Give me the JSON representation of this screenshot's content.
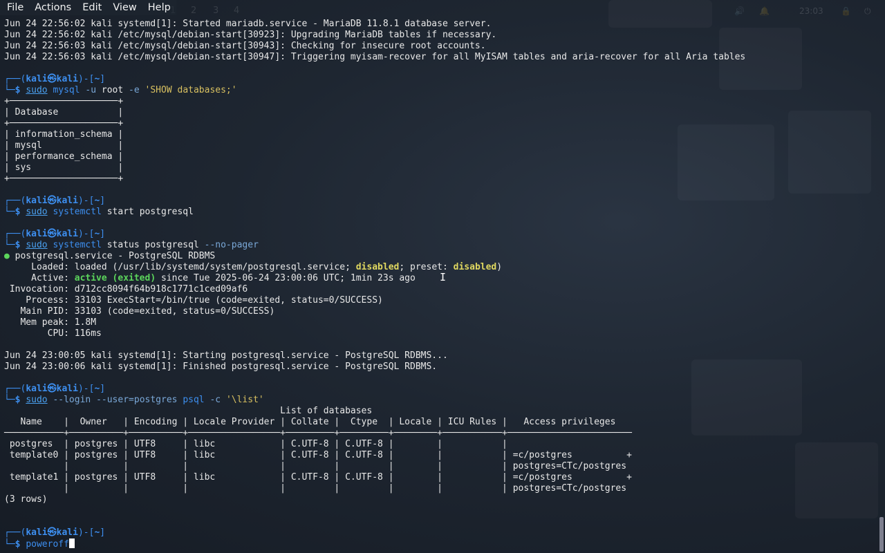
{
  "menu": {
    "items": [
      "File",
      "Actions",
      "Edit",
      "View",
      "Help"
    ]
  },
  "topbar": {
    "workspaces": [
      "1",
      "2",
      "3",
      "4"
    ],
    "clock": "23:03"
  },
  "terminal": {
    "lines": [
      "Jun 24 22:56:02 kali systemd[1]: Started mariadb.service - MariaDB 11.8.1 database server.",
      "Jun 24 22:56:02 kali /etc/mysql/debian-start[30923]: Upgrading MariaDB tables if necessary.",
      "Jun 24 22:56:03 kali /etc/mysql/debian-start[30943]: Checking for insecure root accounts.",
      "Jun 24 22:56:03 kali /etc/mysql/debian-start[30947]: Triggering myisam-recover for all MyISAM tables and aria-recover for all Aria tables",
      "",
      "PROMPT",
      "CMD1",
      "+────────────────────+",
      "| Database           |",
      "+────────────────────+",
      "| information_schema |",
      "| mysql              |",
      "| performance_schema |",
      "| sys                |",
      "+────────────────────+",
      "",
      "PROMPT",
      "CMD2",
      "",
      "PROMPT",
      "CMD3",
      "STATUS1",
      "STATUS2",
      "STATUS3",
      " Invocation: d712cc8094f64b918c1771c1ced09af6",
      "    Process: 33103 ExecStart=/bin/true (code=exited, status=0/SUCCESS)",
      "   Main PID: 33103 (code=exited, status=0/SUCCESS)",
      "   Mem peak: 1.8M",
      "        CPU: 116ms",
      "",
      "Jun 24 23:00:05 kali systemd[1]: Starting postgresql.service - PostgreSQL RDBMS...",
      "Jun 24 23:00:06 kali systemd[1]: Finished postgresql.service - PostgreSQL RDBMS.",
      "",
      "PROMPT",
      "CMD4",
      "                                                   List of databases",
      "   Name    |  Owner   | Encoding | Locale Provider | Collate |  Ctype  | Locale | ICU Rules |   Access privileges   ",
      "───────────+──────────+──────────+─────────────────+─────────+─────────+────────+───────────+───────────────────────",
      " postgres  | postgres | UTF8     | libc            | C.UTF-8 | C.UTF-8 |        |           | ",
      " template0 | postgres | UTF8     | libc            | C.UTF-8 | C.UTF-8 |        |           | =c/postgres          +",
      "           |          |          |                 |         |         |        |           | postgres=CTc/postgres",
      " template1 | postgres | UTF8     | libc            | C.UTF-8 | C.UTF-8 |        |           | =c/postgres          +",
      "           |          |          |                 |         |         |        |           | postgres=CTc/postgres",
      "(3 rows)",
      "",
      "",
      "PROMPT",
      "CMD5"
    ],
    "prompt": {
      "open": "┌──(",
      "user": "kali",
      "at": "㉿",
      "host": "kali",
      "mid": ")-[",
      "dir": "~",
      "close": "]",
      "second": "└─$ "
    },
    "cmd1": {
      "sudo": "sudo",
      "bin": "mysql",
      "opt1": "-u",
      "arg1": "root",
      "opt2": "-e",
      "str": "'SHOW databases;'"
    },
    "cmd2": {
      "sudo": "sudo",
      "bin": "systemctl",
      "rest": "start postgresql"
    },
    "cmd3": {
      "sudo": "sudo",
      "bin": "systemctl",
      "rest": "status postgresql",
      "opt": "--no-pager"
    },
    "cmd4": {
      "sudo": "sudo",
      "opt1": "--login",
      "opt2": "--user=postgres",
      "bin": "psql",
      "opt3": "-c",
      "str": "'\\list'"
    },
    "cmd5": {
      "text": "poweroff"
    },
    "status": {
      "bullet": "●",
      "unit": " postgresql.service - PostgreSQL RDBMS",
      "loaded_prefix": "     Loaded: loaded (/usr/lib/systemd/system/postgresql.service; ",
      "loaded_state": "disabled",
      "loaded_mid": "; preset: ",
      "preset_state": "disabled",
      "loaded_end": ")",
      "active_prefix": "     Active: ",
      "active_state": "active (exited)",
      "active_rest": " since Tue 2025-06-24 23:00:06 UTC; 1min 23s ago"
    }
  }
}
